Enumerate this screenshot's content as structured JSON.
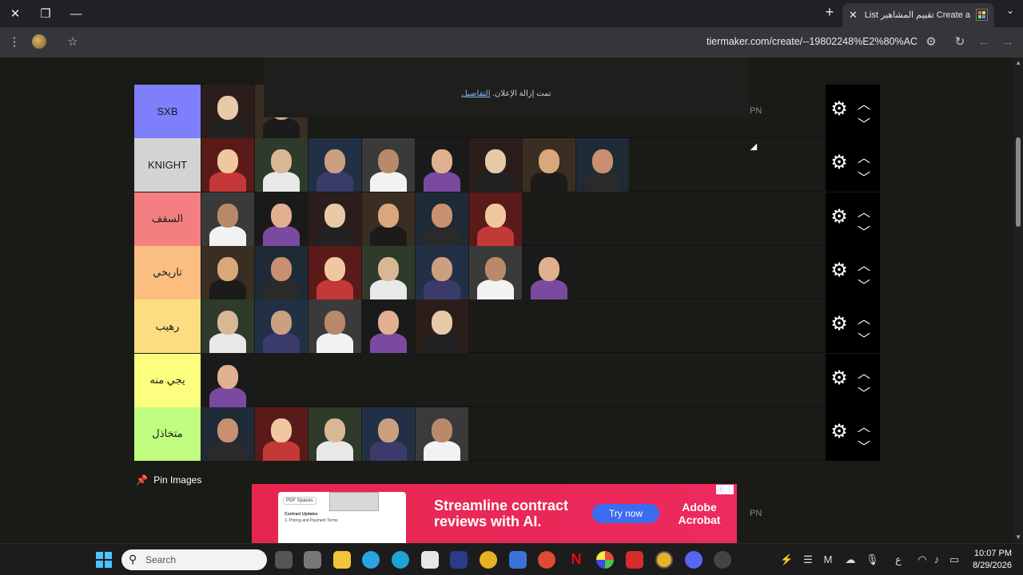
{
  "browser": {
    "tab_title": "Create a تقييم المشاهير Tier List",
    "url": "tiermaker.com/create/--19802248%E2%80%AC",
    "icons": [
      "close-icon",
      "restore-icon",
      "minimize-icon",
      "new-tab-icon",
      "tab-close-icon",
      "tab-menu-icon",
      "menu-icon",
      "star-icon",
      "tune-icon",
      "reload-icon",
      "back-icon",
      "forward-icon"
    ]
  },
  "ad_notice": {
    "text": "تمت إزالة الإعلان.",
    "link": "التفاصيل"
  },
  "pn_marker": "PN",
  "tiers": [
    {
      "label": "SXB",
      "color": "#7f7ffb",
      "items": 2
    },
    {
      "label": "KNIGHT",
      "color": "#d3d3d3",
      "items": 8
    },
    {
      "label": "السقف",
      "color": "#f47f80",
      "items": 6
    },
    {
      "label": "تاريخي",
      "color": "#fabf80",
      "items": 7
    },
    {
      "label": "رهيب",
      "color": "#fbde80",
      "items": 5
    },
    {
      "label": "يجي منه",
      "color": "#fbfe7e",
      "items": 1
    },
    {
      "label": "متخاذل",
      "color": "#c0fd7f",
      "items": 5
    }
  ],
  "pin_images_label": "Pin Images",
  "ad_banner": {
    "doc_chip": "PDF Spaces",
    "doc_heading": "Contract Updates",
    "doc_line": "1. Pricing and Payment Terms",
    "headline_line1": "Streamline contract",
    "headline_line2": "reviews with AI.",
    "cta": "Try now",
    "brand_line1": "Adobe",
    "brand_line2": "Acrobat"
  },
  "taskbar": {
    "search_placeholder": "Search",
    "time": "10:07 PM",
    "date": "8/29/2026",
    "lang": "ع"
  }
}
